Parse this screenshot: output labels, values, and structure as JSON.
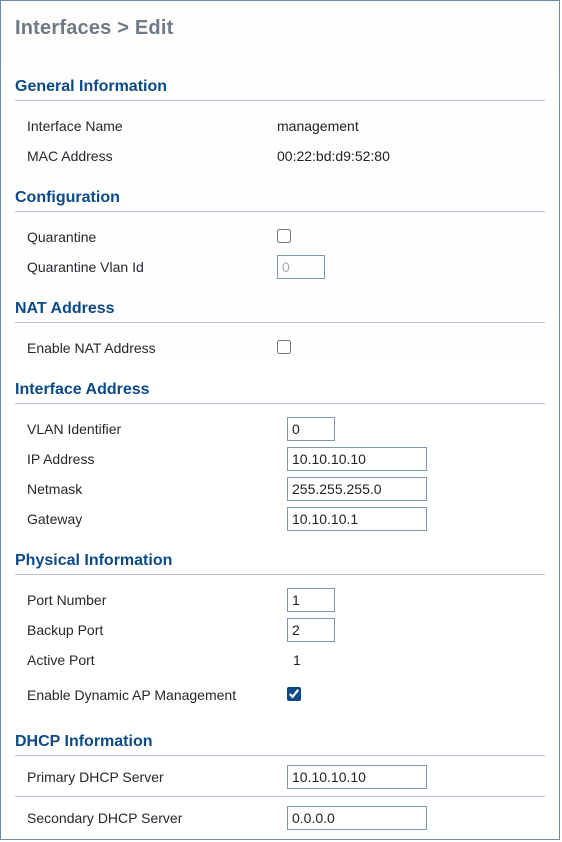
{
  "breadcrumb": {
    "path": "Interfaces > Edit"
  },
  "sections": {
    "general": {
      "title": "General Information",
      "interface_name_label": "Interface Name",
      "interface_name_value": "management",
      "mac_label": "MAC Address",
      "mac_value": "00:22:bd:d9:52:80"
    },
    "configuration": {
      "title": "Configuration",
      "quarantine_label": "Quarantine",
      "quarantine_checked": false,
      "quarantine_vlan_label": "Quarantine Vlan Id",
      "quarantine_vlan_value": "0"
    },
    "nat": {
      "title": "NAT Address",
      "enable_label": "Enable NAT Address",
      "enable_checked": false
    },
    "ifaddr": {
      "title": "Interface Address",
      "vlan_label": "VLAN Identifier",
      "vlan_value": "0",
      "ip_label": "IP Address",
      "ip_value": "10.10.10.10",
      "netmask_label": "Netmask",
      "netmask_value": "255.255.255.0",
      "gateway_label": "Gateway",
      "gateway_value": "10.10.10.1"
    },
    "phys": {
      "title": "Physical Information",
      "port_label": "Port Number",
      "port_value": "1",
      "backup_label": "Backup Port",
      "backup_value": "2",
      "active_label": "Active Port",
      "active_value": "1",
      "dynap_label": "Enable Dynamic AP Management",
      "dynap_checked": true
    },
    "dhcp": {
      "title": "DHCP Information",
      "primary_label": "Primary DHCP Server",
      "primary_value": "10.10.10.10",
      "secondary_label": "Secondary DHCP Server",
      "secondary_value": "0.0.0.0"
    }
  }
}
